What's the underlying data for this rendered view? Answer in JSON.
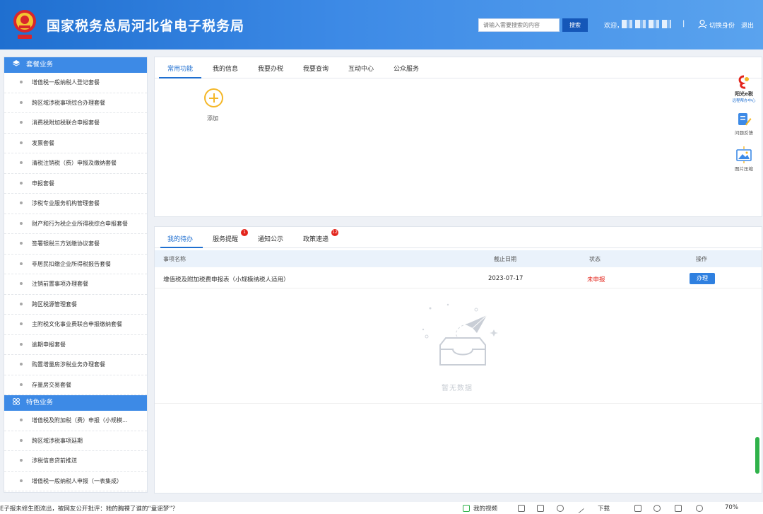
{
  "header": {
    "title": "国家税务总局河北省电子税务局",
    "search_placeholder": "请输入需要搜索的内容",
    "search_button": "搜索",
    "welcome": "欢迎，",
    "separator": "|",
    "switch_identity": "切换身份",
    "logout": "退出",
    "brand_color": "#2a7ad9"
  },
  "sidebar": {
    "section1": {
      "label": "套餐业务",
      "items": [
        "增值税一般纳税人登记套餐",
        "跨区域涉税事项综合办理套餐",
        "消费税附加税联合申报套餐",
        "发票套餐",
        "清税注销税（费）申报及缴纳套餐",
        "申报套餐",
        "涉税专业服务机构管理套餐",
        "财产和行为税企业所得税综合申报套餐",
        "签署银税三方划缴协议套餐",
        "非居民扣缴企业所得税报告套餐",
        "注销前置事项办理套餐",
        "跨区税源管理套餐",
        "主附税文化事业费联合申报缴纳套餐",
        "逾期申报套餐",
        "购置增量房涉税业务办理套餐",
        "存量房交易套餐"
      ]
    },
    "section2": {
      "label": "特色业务",
      "items": [
        "增值税及附加税（费）申报（小规模...",
        "跨区域涉税事项延期",
        "涉税信息贷前推送",
        "增值税一般纳税人申报（一表集成）"
      ]
    }
  },
  "top_tabs": [
    "常用功能",
    "我的信息",
    "我要办税",
    "我要查询",
    "互动中心",
    "公众服务"
  ],
  "add_label": "添加",
  "widgets": {
    "w1_line1": "阳光e税",
    "w1_line2": "远程帮办中心",
    "w2": "问题反馈",
    "w3": "图片压缩"
  },
  "bottom_tabs": {
    "t1": "我的待办",
    "t2": "服务提醒",
    "t2_badge": "1",
    "t3": "通知公示",
    "t4": "政策速递",
    "t4_badge": "12"
  },
  "table": {
    "headers": {
      "name": "事项名称",
      "deadline": "截止日期",
      "status": "状态",
      "action": "操作"
    },
    "row": {
      "name": "增值税及附加税费申报表（小规模纳税人适用）",
      "deadline": "2023-07-17",
      "status": "未申报",
      "action": "办理"
    },
    "empty_text": "暂无数据"
  },
  "bottombar": {
    "news": "E子报未修生图流出，被网友公开批评：她的胸裸了谁的“童谣梦”？",
    "video": "我的视频",
    "download": "下载",
    "zoom": "70%"
  }
}
